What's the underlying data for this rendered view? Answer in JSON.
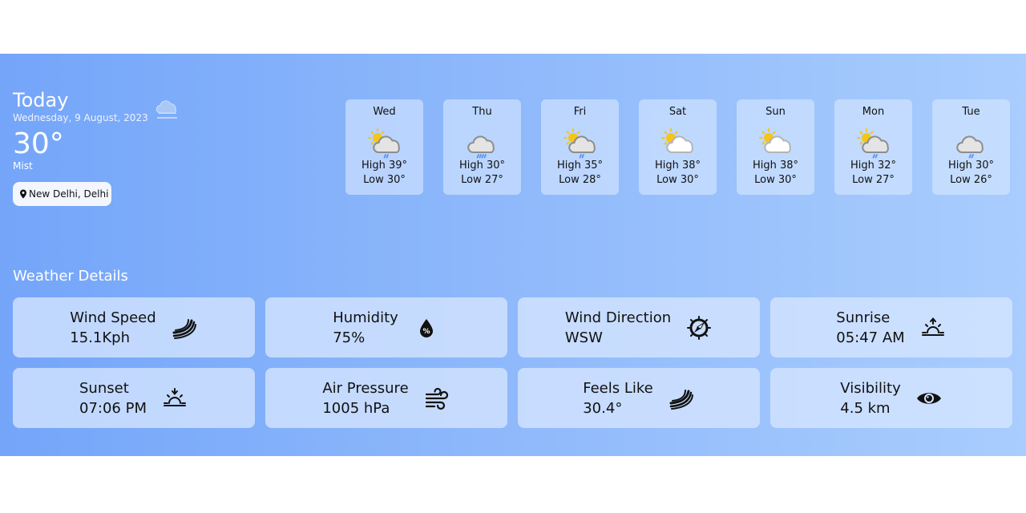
{
  "today": {
    "title": "Today",
    "date": "Wednesday, 9 August, 2023",
    "temperature": "30°",
    "condition": "Mist",
    "icon": "mist-cloud-icon",
    "location": "New Delhi, Delhi"
  },
  "forecast": [
    {
      "day": "Wed",
      "high": "High 39°",
      "low": "Low 30°",
      "icon": "sun-cloud-light-rain-icon"
    },
    {
      "day": "Thu",
      "high": "High 30°",
      "low": "Low 27°",
      "icon": "cloud-rain-icon"
    },
    {
      "day": "Fri",
      "high": "High 35°",
      "low": "Low 28°",
      "icon": "sun-cloud-light-rain-icon"
    },
    {
      "day": "Sat",
      "high": "High 38°",
      "low": "Low 30°",
      "icon": "partly-cloudy-icon"
    },
    {
      "day": "Sun",
      "high": "High 38°",
      "low": "Low 30°",
      "icon": "partly-cloudy-icon"
    },
    {
      "day": "Mon",
      "high": "High 32°",
      "low": "Low 27°",
      "icon": "sun-cloud-light-rain-icon"
    },
    {
      "day": "Tue",
      "high": "High 30°",
      "low": "Low 26°",
      "icon": "cloud-light-rain-icon"
    }
  ],
  "details": {
    "title": "Weather Details",
    "items": [
      {
        "label": "Wind Speed",
        "value": "15.1Kph",
        "icon": "wind-icon"
      },
      {
        "label": "Humidity",
        "value": "75%",
        "icon": "humidity-drop-icon"
      },
      {
        "label": "Wind Direction",
        "value": "WSW",
        "icon": "compass-icon"
      },
      {
        "label": "Sunrise",
        "value": "05:47 AM",
        "icon": "sunrise-icon"
      },
      {
        "label": "Sunset",
        "value": "07:06 PM",
        "icon": "sunset-icon"
      },
      {
        "label": "Air Pressure",
        "value": "1005 hPa",
        "icon": "air-pressure-icon"
      },
      {
        "label": "Feels Like",
        "value": "30.4°",
        "icon": "wind-icon"
      },
      {
        "label": "Visibility",
        "value": "4.5 km",
        "icon": "eye-icon"
      }
    ]
  },
  "colors": {
    "panel_start": "#74a5f9",
    "panel_end": "#a9cdfd",
    "sun": "#f5c518",
    "rain": "#5b8ff0",
    "cloud_fill": "#e6e6e6",
    "cloud_stroke": "#8f8f8f"
  }
}
